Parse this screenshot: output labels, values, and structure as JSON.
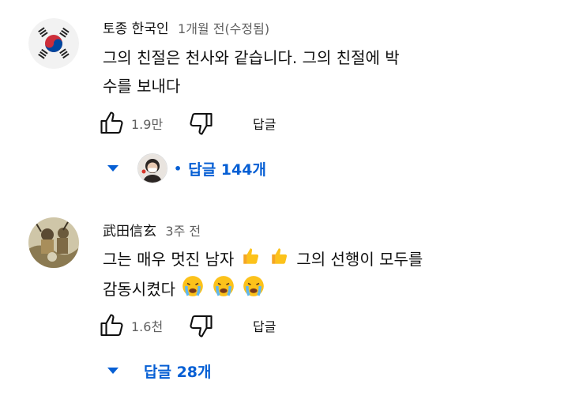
{
  "comments": [
    {
      "author": "토종 한국인",
      "time": "1개월 전(수정됨)",
      "text_line1": "그의 친절은 천사와 같습니다. 그의 친절에 박",
      "text_line2": "수를 보내다",
      "likes": "1.9만",
      "reply_label": "답글",
      "replies_label": "답글 144개"
    },
    {
      "author": "武田信玄",
      "time": "3주 전",
      "text_part1": "그는 매우 멋진 남자",
      "text_part2": "그의 선행이 모두를",
      "text_line2": "감동시켰다",
      "likes": "1.6천",
      "reply_label": "답글",
      "replies_label": "답글 28개"
    }
  ],
  "icons": {
    "like": "thumbs-up-icon",
    "dislike": "thumbs-down-icon",
    "expand": "caret-down-icon",
    "emoji_1": "thumbs-up-emoji",
    "emoji_2": "crying-face-emoji"
  },
  "colors": {
    "link_blue": "#065fd4",
    "meta_gray": "#606060",
    "text": "#0f0f0f"
  }
}
